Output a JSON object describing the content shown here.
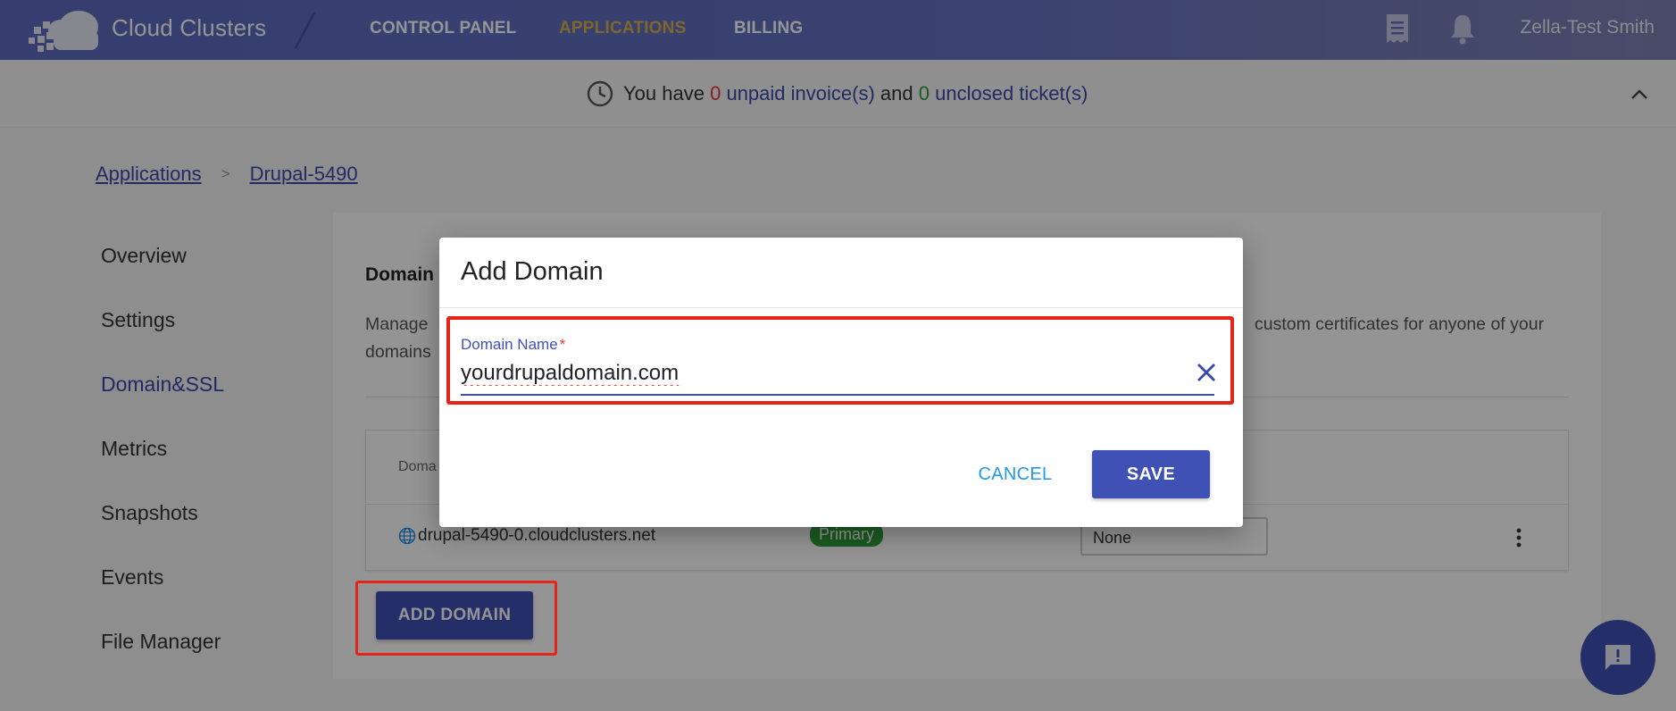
{
  "app": {
    "brand": "Cloud Clusters"
  },
  "nav": {
    "items": [
      {
        "label": "CONTROL PANEL"
      },
      {
        "label": "APPLICATIONS"
      },
      {
        "label": "BILLING"
      }
    ],
    "user": "Zella-Test Smith"
  },
  "notice": {
    "prefix": "You have",
    "invoice_count": "0",
    "invoice_label": "unpaid invoice(s)",
    "and": "and",
    "ticket_count": "0",
    "ticket_label": "unclosed ticket(s)"
  },
  "breadcrumb": {
    "root": "Applications",
    "separator": ">",
    "current": "Drupal-5490"
  },
  "menu": {
    "items": [
      {
        "label": "Overview"
      },
      {
        "label": "Settings"
      },
      {
        "label": "Domain&SSL"
      },
      {
        "label": "Metrics"
      },
      {
        "label": "Snapshots"
      },
      {
        "label": "Events"
      },
      {
        "label": "File Manager"
      }
    ]
  },
  "content": {
    "heading": "Domain",
    "description_start": "Manage",
    "description_end": "custom certificates for anyone of your",
    "description_line2": "domains",
    "table_header": "Doma",
    "row": {
      "domain": "drupal-5490-0.cloudclusters.net",
      "badge": "Primary",
      "ssl": "None"
    },
    "add_button": "ADD DOMAIN"
  },
  "modal": {
    "title": "Add Domain",
    "field_label": "Domain Name",
    "required_mark": "*",
    "field_value": "yourdrupaldomain.com",
    "cancel": "CANCEL",
    "save": "SAVE"
  },
  "colors": {
    "brand": "#5c6bc0",
    "primary": "#3f51b5",
    "accent": "#d9b24a",
    "highlight": "#e5251c",
    "success": "#2e9e3a"
  }
}
